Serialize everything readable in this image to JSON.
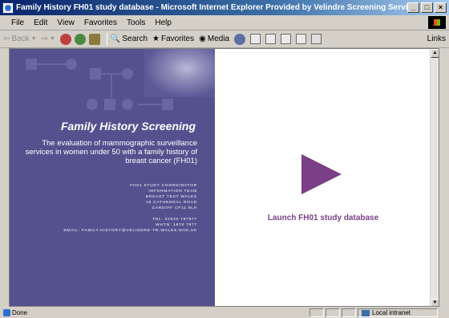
{
  "window": {
    "title": "Family History FH01 study database - Microsoft Internet Explorer Provided by Velindre Screening Services",
    "buttons": [
      "_",
      "□",
      "×"
    ]
  },
  "menubar": {
    "items": [
      "File",
      "Edit",
      "View",
      "Favorites",
      "Tools",
      "Help"
    ]
  },
  "toolbar": {
    "back": "Back",
    "search": "Search",
    "favorites": "Favorites",
    "media": "Media",
    "links": "Links"
  },
  "page": {
    "heading": "Family History Screening",
    "description": "The evaluation of mammographic surveillance services in women under 50 with a family history of breast cancer (FH01)",
    "contact_lines": [
      "FH01 STUDY COORDINATOR",
      "INFORMATION TEAM",
      "BREAST TEST WALES",
      "18 CATHEDRAL ROAD",
      "CARDIFF CF11 9LH"
    ],
    "phone_lines": [
      "TEL: 02920 787877",
      "WHTN: 1870 7877",
      "EMAIL: FAMILY.HISTORY@VELINDRE-TR.WALES.NHS.UK"
    ],
    "launch_label": "Launch FH01 study database",
    "accent_color": "#7a3f86",
    "panel_color": "#55518f"
  },
  "statusbar": {
    "status": "Done",
    "zone": "Local intranet"
  }
}
